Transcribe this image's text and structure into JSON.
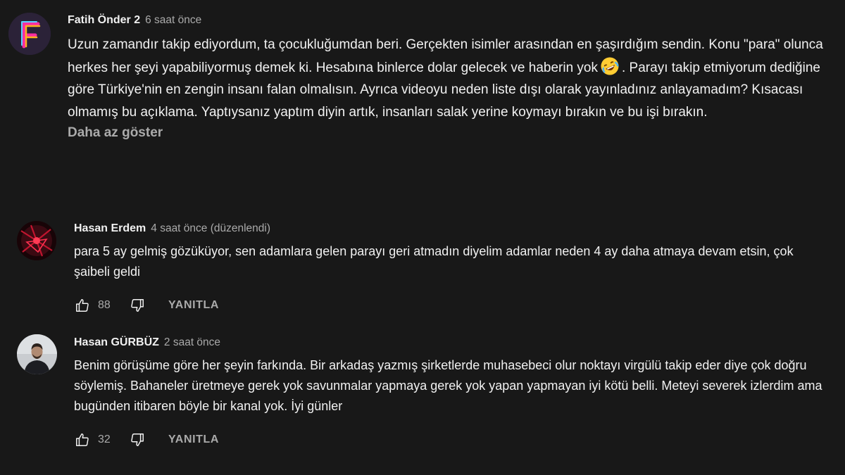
{
  "comments": [
    {
      "author": "Fatih Önder 2",
      "time": "6 saat önce",
      "text_part1": "Uzun zamandır takip ediyordum, ta çocukluğumdan beri. Gerçekten isimler arasından en şaşırdığım sendin. Konu \"para\" olunca herkes her şeyi yapabiliyormuş demek ki. Hesabına binlerce dolar gelecek ve haberin yok",
      "emoji": "rolling-on-floor-laughing-emoji",
      "text_part2": ". Parayı takip etmiyorum dediğine göre Türkiye'nin en zengin insanı falan olmalısın. Ayrıca videoyu neden liste dışı olarak yayınladınız anlayamadım? Kısacası olmamış bu açıklama. Yaptıysanız yaptım diyin artık, insanları salak yerine koymayı bırakın ve bu işi bırakın.",
      "show_less": "Daha az göster"
    },
    {
      "author": "Hasan Erdem",
      "time": "4 saat önce (düzenlendi)",
      "text": "para 5 ay gelmiş gözüküyor, sen adamlara gelen parayı geri atmadın diyelim adamlar neden 4 ay daha atmaya devam etsin, çok şaibeli geldi",
      "likes": "88",
      "reply_label": "YANITLA"
    },
    {
      "author": "Hasan GÜRBÜZ",
      "time": "2 saat önce",
      "text": "Benim görüşüme göre her şeyin farkında. Bir arkadaş yazmış şirketlerde muhasebeci olur noktayı virgülü takip eder diye çok doğru söylemiş. Bahaneler üretmeye gerek yok savunmalar yapmaya gerek yok yapan yapmayan iyi kötü belli. Meteyi severek izlerdim ama bugünden itibaren böyle bir kanal yok. İyi günler",
      "likes": "32",
      "reply_label": "YANITLA"
    }
  ],
  "icons": {
    "like": "thumbs-up-icon",
    "dislike": "thumbs-down-icon"
  },
  "colors": {
    "background": "#181818",
    "primary_text": "#f1f1f1",
    "secondary_text": "#aaaaaa"
  }
}
